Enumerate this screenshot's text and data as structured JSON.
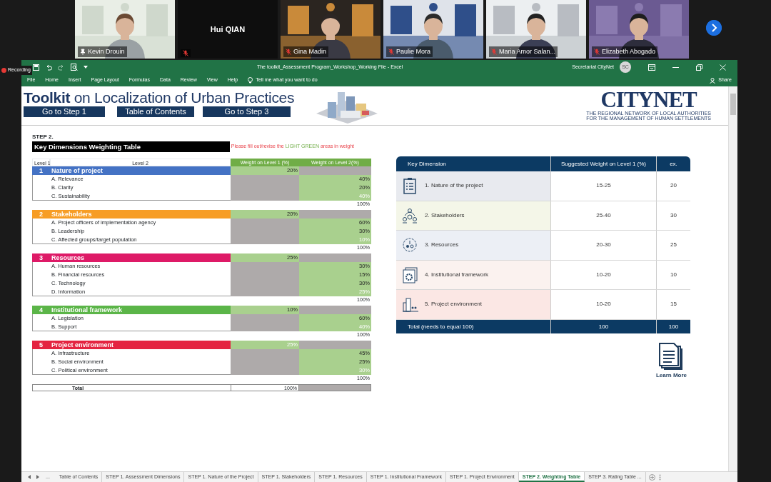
{
  "meeting": {
    "recording": "Recording",
    "participants": [
      {
        "name": "Kevin Drouin",
        "kind": "video",
        "pinned": true,
        "muted": false
      },
      {
        "name": "Hui QIAN",
        "kind": "name_only",
        "pinned": false,
        "muted": true
      },
      {
        "name": "Gina Madin",
        "kind": "video",
        "pinned": false,
        "muted": true
      },
      {
        "name": "Paulie Mora",
        "kind": "video",
        "pinned": false,
        "muted": true
      },
      {
        "name": "Maria Amor Salan...",
        "kind": "video",
        "pinned": false,
        "muted": true
      },
      {
        "name": "Elizabeth Abogado",
        "kind": "video",
        "pinned": false,
        "muted": true
      }
    ]
  },
  "excel": {
    "title": "The toolkit_Assessment Program_Workshop_Working File  -  Excel",
    "user": "Secretariat CityNet",
    "user_initials": "SC",
    "menu": [
      "File",
      "Home",
      "Insert",
      "Page Layout",
      "Formulas",
      "Data",
      "Review",
      "View",
      "Help"
    ],
    "tell_me": "Tell me what you want to do",
    "share": "Share",
    "sheet": {
      "banner": {
        "title": "**Toolkit** on Localization of Urban Practices",
        "buttons": [
          "Go to Step 1",
          "Table of Contents",
          "Go to Step 3"
        ],
        "logo": "CITYNET",
        "logo_subtitle": [
          "THE REGIONAL NETWORK OF LOCAL AUTHORITIES",
          "FOR THE MANAGEMENT OF HUMAN SETTLEMENTS"
        ]
      },
      "step": "STEP 2.",
      "table_title": "Key Dimensions Weighting Table",
      "instruction": {
        "before": "Please fill out/revise the ",
        "highlight": "LIGHT GREEN",
        "after": " areas in weight"
      },
      "weights": {
        "columns": [
          "Level 1",
          "Level 2",
          "Weight on Level 1 (%)",
          "Weight on Level 2(%)"
        ],
        "sections": [
          {
            "number": "1",
            "title": "Nature of project",
            "color": "#4472c4",
            "weight": "20%",
            "faded": false,
            "subtotal": "100%",
            "items": [
              {
                "label": "A. Relevance",
                "weight": "40%",
                "faded": false
              },
              {
                "label": "B. Clarity",
                "weight": "20%",
                "faded": false
              },
              {
                "label": "C. Sustainability",
                "weight": "40%",
                "faded": true
              }
            ]
          },
          {
            "number": "2",
            "title": "Stakeholders",
            "color": "#f79d25",
            "weight": "20%",
            "faded": false,
            "subtotal": "100%",
            "items": [
              {
                "label": "A. Project officers of implementation agency",
                "weight": "60%",
                "faded": false
              },
              {
                "label": "B. Leadership",
                "weight": "30%",
                "faded": false
              },
              {
                "label": "C. Affected groups/target population",
                "weight": "10%",
                "faded": true
              }
            ]
          },
          {
            "number": "3",
            "title": "Resources",
            "color": "#de1a67",
            "weight": "25%",
            "faded": false,
            "subtotal": "100%",
            "items": [
              {
                "label": "A. Human resources",
                "weight": "30%",
                "faded": false
              },
              {
                "label": "B. Financial resources",
                "weight": "15%",
                "faded": false
              },
              {
                "label": "C. Technology",
                "weight": "30%",
                "faded": false
              },
              {
                "label": "D. Information",
                "weight": "25%",
                "faded": true
              }
            ]
          },
          {
            "number": "4",
            "title": "Institutional framework",
            "color": "#5bb548",
            "weight": "10%",
            "faded": false,
            "subtotal": "100%",
            "items": [
              {
                "label": "A. Legislation",
                "weight": "60%",
                "faded": false
              },
              {
                "label": "B. Support",
                "weight": "40%",
                "faded": true
              }
            ]
          },
          {
            "number": "5",
            "title": "Project environment",
            "color": "#e42341",
            "weight": "25%",
            "faded": true,
            "subtotal": "100%",
            "items": [
              {
                "label": "A. Infrastructure",
                "weight": "45%",
                "faded": false
              },
              {
                "label": "B. Social environment",
                "weight": "25%",
                "faded": false
              },
              {
                "label": "C. Political environment",
                "weight": "30%",
                "faded": true
              }
            ]
          }
        ],
        "total": {
          "label": "Total",
          "value": "100%"
        }
      },
      "suggested": {
        "columns": [
          "Key Dimension",
          "Suggested Weight on Level 1 (%)",
          "ex."
        ],
        "rows": [
          {
            "dimension": "1. Nature of the project",
            "range": "15-25",
            "example": "20",
            "color": "#e8eaef"
          },
          {
            "dimension": "2. Stakeholders",
            "range": "25-40",
            "example": "30",
            "color": "#f4f6e8"
          },
          {
            "dimension": "3. Resources",
            "range": "20-30",
            "example": "25",
            "color": "#eceff5"
          },
          {
            "dimension": "4. Institutional framework",
            "range": "10-20",
            "example": "10",
            "color": "#fbf2ef"
          },
          {
            "dimension": "5. Project environment",
            "range": "10-20",
            "example": "15",
            "color": "#fbe7e4"
          }
        ],
        "total": {
          "label": "Total (needs to equal 100)",
          "range": "100",
          "example": "100"
        }
      },
      "learn_more": "Learn More"
    },
    "more_tabs": "...",
    "sheet_tabs": [
      {
        "label": "Table of Contents",
        "selected": false
      },
      {
        "label": "STEP 1. Assessment Dimensions",
        "selected": false
      },
      {
        "label": "STEP 1. Nature of the Project",
        "selected": false
      },
      {
        "label": "STEP 1. Stakeholders",
        "selected": false
      },
      {
        "label": "STEP 1. Resources",
        "selected": false
      },
      {
        "label": "STEP 1. Institutional Framework",
        "selected": false
      },
      {
        "label": "STEP 1. Project Environment",
        "selected": false
      },
      {
        "label": "STEP 2. Weighting Table",
        "selected": true
      },
      {
        "label": "STEP 3. Rating Table ...",
        "selected": false
      }
    ]
  }
}
